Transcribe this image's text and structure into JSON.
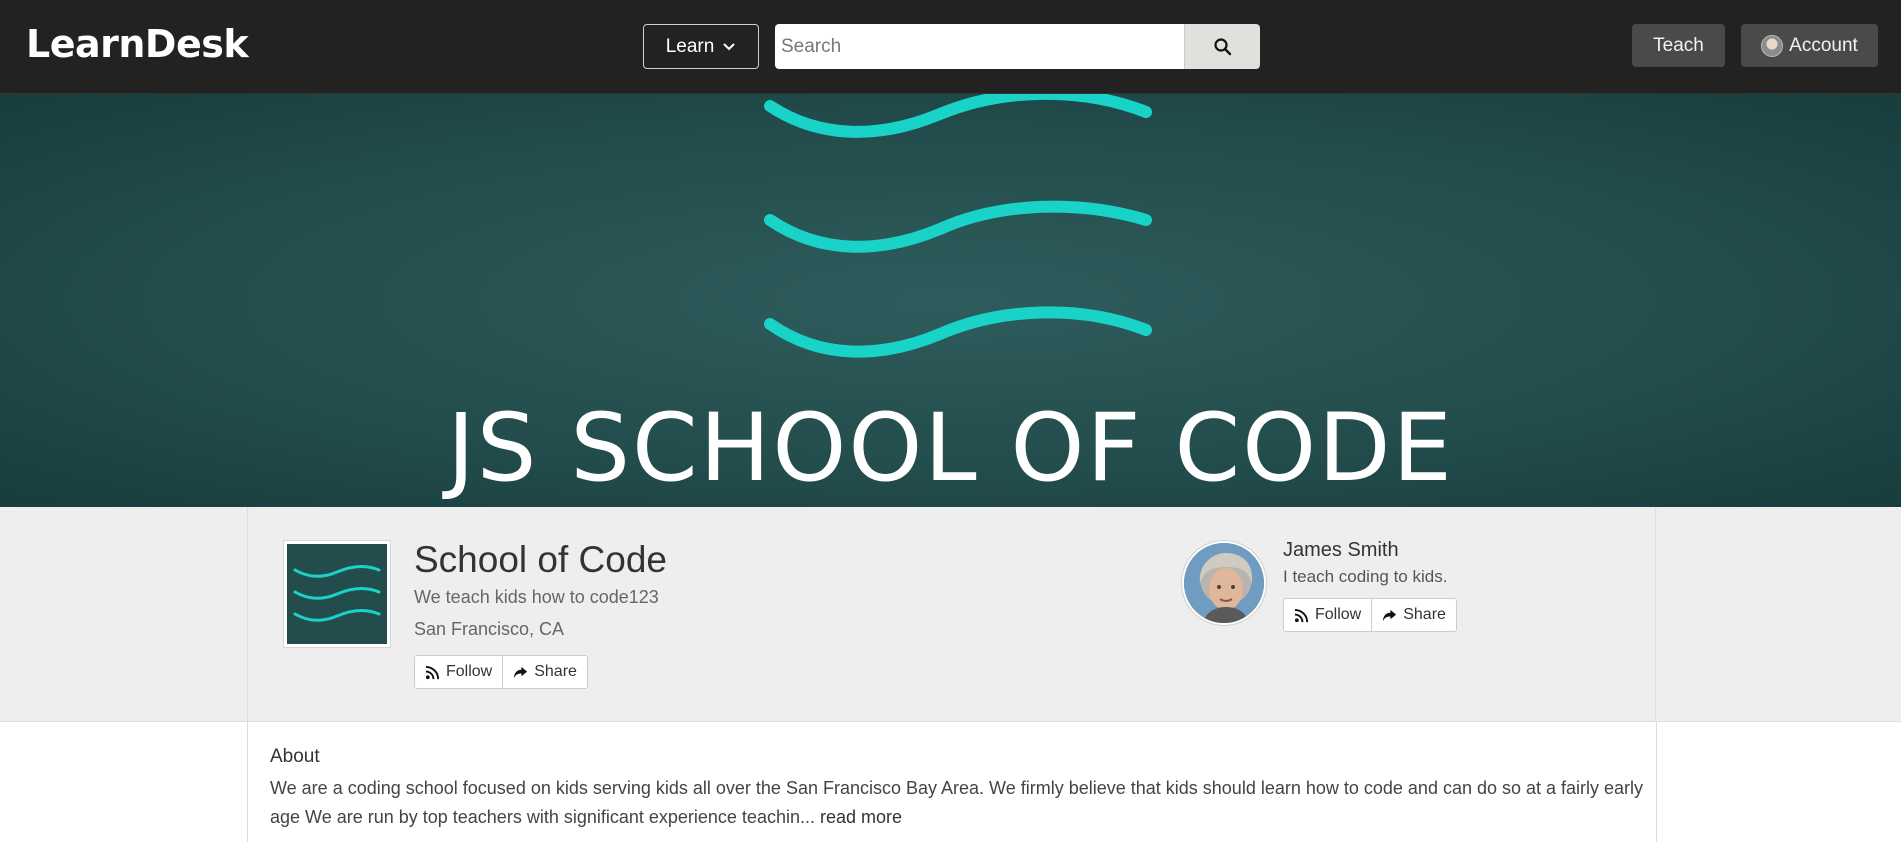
{
  "navbar": {
    "brand": "LearnDesk",
    "learn_label": "Learn",
    "search_placeholder": "Search",
    "teach_label": "Teach",
    "account_label": "Account"
  },
  "banner": {
    "title": "JS SCHOOL OF CODE",
    "wave_color": "#19d3c8",
    "background_color": "#244d4d"
  },
  "school": {
    "name": "School of Code",
    "tagline": "We teach kids how to code123",
    "location": "San Francisco, CA",
    "follow_label": "Follow",
    "share_label": "Share"
  },
  "teacher": {
    "name": "James Smith",
    "bio": "I teach coding to kids.",
    "follow_label": "Follow",
    "share_label": "Share"
  },
  "about": {
    "title": "About",
    "text": "We are a coding school focused on kids serving kids all over the San Francisco Bay Area. We firmly believe that kids should learn how to code and can do so at a fairly early age We are run by top teachers with significant experience teachin...",
    "read_more": "read more"
  }
}
